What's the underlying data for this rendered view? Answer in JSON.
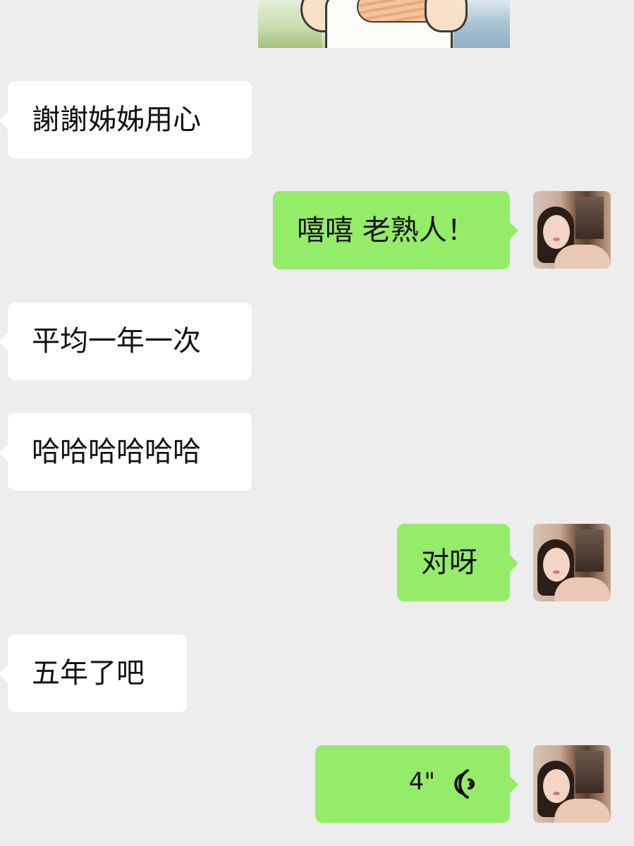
{
  "messages": [
    {
      "side": "left",
      "text": "謝謝姊姊用心"
    },
    {
      "side": "right",
      "text": "嘻嘻 老熟人！"
    },
    {
      "side": "left",
      "text": "平均一年一次"
    },
    {
      "side": "left",
      "text": "哈哈哈哈哈哈"
    },
    {
      "side": "right",
      "text": "对呀"
    },
    {
      "side": "left",
      "text": "五年了吧"
    },
    {
      "side": "right",
      "type": "voice",
      "duration": "4\""
    }
  ],
  "colors": {
    "background": "#ededed",
    "left_bubble": "#ffffff",
    "right_bubble": "#95ec69",
    "text": "#111111"
  },
  "icons": {
    "voice": "voice-wave-icon",
    "sticker": "cartoon-sticker-image",
    "avatar": "user-avatar-photo"
  }
}
